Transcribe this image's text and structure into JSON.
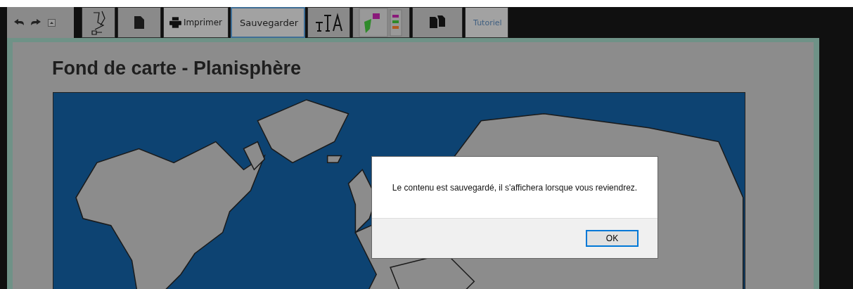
{
  "toolbar": {
    "tools": [
      {
        "kind": "undo-redo",
        "selected": false
      },
      {
        "kind": "draw",
        "selected": false
      },
      {
        "kind": "file",
        "selected": false
      },
      {
        "kind": "print",
        "label": "Imprimer",
        "selected": false
      },
      {
        "kind": "text",
        "label": "Sauvegarder",
        "selected": true
      },
      {
        "kind": "font",
        "selected": false
      },
      {
        "kind": "legend",
        "selected": false
      },
      {
        "kind": "copy",
        "selected": false
      },
      {
        "kind": "text",
        "label": "Tutoriel",
        "selected": false
      }
    ]
  },
  "page": {
    "title": "Fond de carte - Planisphère"
  },
  "dialog": {
    "message": "Le contenu est sauvegardé, il s'affichera lorsque vous reviendrez.",
    "button": "OK"
  }
}
